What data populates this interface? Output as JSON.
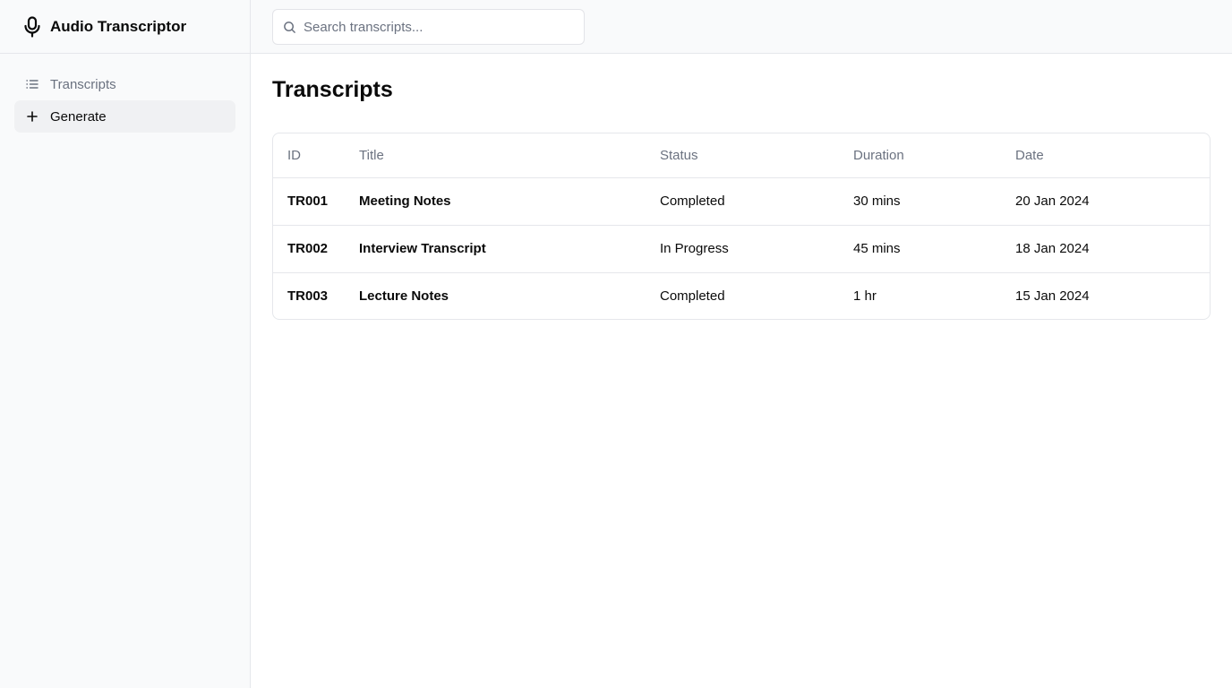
{
  "app": {
    "title": "Audio Transcriptor",
    "logo_icon": "microphone-icon"
  },
  "sidebar": {
    "items": [
      {
        "label": "Transcripts",
        "icon": "list-icon",
        "active": false
      },
      {
        "label": "Generate",
        "icon": "plus-icon",
        "active": true
      }
    ]
  },
  "search": {
    "placeholder": "Search transcripts...",
    "value": ""
  },
  "main": {
    "title": "Transcripts",
    "table": {
      "columns": [
        "ID",
        "Title",
        "Status",
        "Duration",
        "Date"
      ],
      "rows": [
        {
          "id": "TR001",
          "title": "Meeting Notes",
          "status": "Completed",
          "duration": "30 mins",
          "date": "20 Jan 2024"
        },
        {
          "id": "TR002",
          "title": "Interview Transcript",
          "status": "In Progress",
          "duration": "45 mins",
          "date": "18 Jan 2024"
        },
        {
          "id": "TR003",
          "title": "Lecture Notes",
          "status": "Completed",
          "duration": "1 hr",
          "date": "15 Jan 2024"
        }
      ]
    }
  },
  "colors": {
    "sidebar_bg": "#f9fafb",
    "border": "#e5e7eb",
    "muted_text": "#6b7280",
    "active_bg": "#f0f1f3",
    "text": "#0a0a0a"
  }
}
